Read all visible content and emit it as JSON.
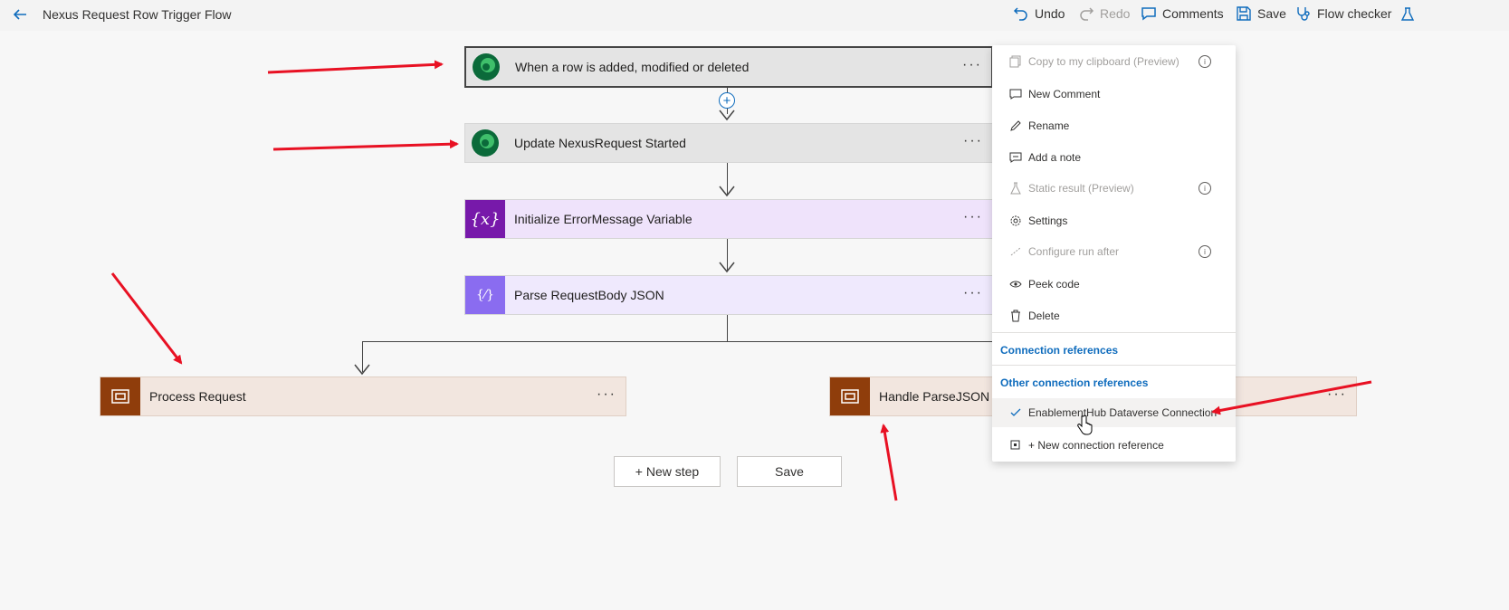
{
  "header": {
    "title": "Nexus Request Row Trigger Flow",
    "undo": "Undo",
    "redo": "Redo",
    "comments": "Comments",
    "save": "Save",
    "flow_checker": "Flow checker"
  },
  "steps": {
    "trigger": "When a row is added, modified or deleted",
    "update": "Update NexusRequest Started",
    "init_var": "Initialize ErrorMessage Variable",
    "parse": "Parse RequestBody JSON",
    "process": "Process Request",
    "handle": "Handle ParseJSON Fa",
    "dots": "···",
    "var_glyph": "{x}",
    "parse_glyph": "{⁄}"
  },
  "buttons": {
    "new_step": "+ New step",
    "save": "Save"
  },
  "menu": {
    "copy": "Copy to my clipboard (Preview)",
    "new_comment": "New Comment",
    "rename": "Rename",
    "add_note": "Add a note",
    "static_result": "Static result (Preview)",
    "settings": "Settings",
    "configure_run_after": "Configure run after",
    "peek_code": "Peek code",
    "delete": "Delete",
    "connection_references": "Connection references",
    "other_connection_references": "Other connection references",
    "selected_connection": "EnablementHub Dataverse Connection",
    "new_connection_reference": "+ New connection reference",
    "info_glyph": "i"
  },
  "colors": {
    "annotation_arrow": "#e81123",
    "accent": "#0f6cbd",
    "variable": "#7719aa",
    "parse_json": "#8a6cf0",
    "scope": "#8f3d0b"
  }
}
